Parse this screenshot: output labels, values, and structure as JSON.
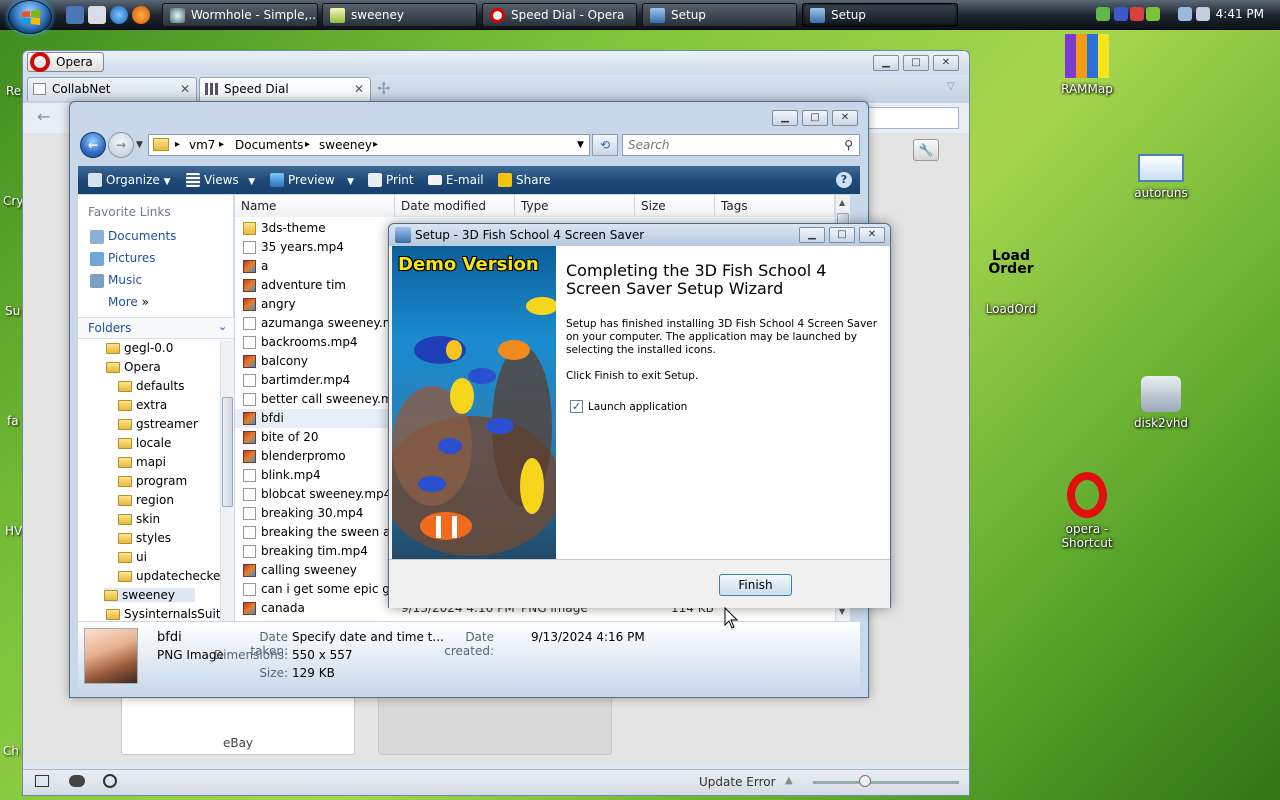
{
  "taskbar": {
    "tasks": [
      {
        "label": "Wormhole - Simple,..."
      },
      {
        "label": "sweeney"
      },
      {
        "label": "Speed Dial - Opera"
      },
      {
        "label": "Setup"
      },
      {
        "label": "Setup"
      }
    ],
    "clock": "4:41 PM"
  },
  "desktop": {
    "icons": [
      {
        "label": "RAMMap"
      },
      {
        "label": "autoruns"
      },
      {
        "label": "LoadOrd",
        "logo_text": "Load Order"
      },
      {
        "label": "disk2vhd"
      },
      {
        "label": "opera - Shortcut"
      }
    ],
    "edge_labels": [
      "Re",
      "Cry",
      "Su",
      "fa",
      "HV",
      "Ch"
    ]
  },
  "opera": {
    "menu_label": "Opera",
    "tabs": [
      {
        "label": "CollabNet"
      },
      {
        "label": "Speed Dial"
      }
    ],
    "add_tab": "✢",
    "dial_tile_label": "eBay",
    "status": {
      "update_text": "Update Error"
    }
  },
  "explorer": {
    "breadcrumb": [
      "vm7",
      "Documents",
      "sweeney"
    ],
    "search_placeholder": "Search",
    "toolbar": {
      "organize": "Organize",
      "views": "Views",
      "preview": "Preview",
      "print": "Print",
      "email": "E-mail",
      "share": "Share"
    },
    "favorite_links_header": "Favorite Links",
    "favorite_links": [
      "Documents",
      "Pictures",
      "Music"
    ],
    "more_label": "More",
    "folders_header": "Folders",
    "tree": [
      {
        "label": "gegl-0.0",
        "level": 0
      },
      {
        "label": "Opera",
        "level": 0
      },
      {
        "label": "defaults",
        "level": 1
      },
      {
        "label": "extra",
        "level": 1
      },
      {
        "label": "gstreamer",
        "level": 1
      },
      {
        "label": "locale",
        "level": 1
      },
      {
        "label": "mapi",
        "level": 1
      },
      {
        "label": "program",
        "level": 1
      },
      {
        "label": "region",
        "level": 1
      },
      {
        "label": "skin",
        "level": 1
      },
      {
        "label": "styles",
        "level": 1
      },
      {
        "label": "ui",
        "level": 1
      },
      {
        "label": "updatechecker",
        "level": 1
      },
      {
        "label": "sweeney",
        "level": 0,
        "selected": true
      },
      {
        "label": "SysinternalsSuite",
        "level": 0
      }
    ],
    "columns": [
      "Name",
      "Date modified",
      "Type",
      "Size",
      "Tags"
    ],
    "files": [
      {
        "name": "3ds-theme",
        "kind": "fold"
      },
      {
        "name": "35 years.mp4",
        "kind": "mp4"
      },
      {
        "name": "a",
        "kind": "png"
      },
      {
        "name": "adventure tim",
        "kind": "png"
      },
      {
        "name": "angry",
        "kind": "png"
      },
      {
        "name": "azumanga sweeney.mp4",
        "kind": "mp4"
      },
      {
        "name": "backrooms.mp4",
        "kind": "mp4"
      },
      {
        "name": "balcony",
        "kind": "png"
      },
      {
        "name": "bartimder.mp4",
        "kind": "mp4"
      },
      {
        "name": "better call sweeney.mp4",
        "kind": "mp4"
      },
      {
        "name": "bfdi",
        "kind": "png",
        "selected": true
      },
      {
        "name": "bite of 20",
        "kind": "png"
      },
      {
        "name": "blenderpromo",
        "kind": "png"
      },
      {
        "name": "blink.mp4",
        "kind": "mp4"
      },
      {
        "name": "blobcat sweeney.mp4",
        "kind": "mp4"
      },
      {
        "name": "breaking 30.mp4",
        "kind": "mp4"
      },
      {
        "name": "breaking the sween at ...",
        "kind": "mp4"
      },
      {
        "name": "breaking tim.mp4",
        "kind": "mp4"
      },
      {
        "name": "calling sweeney",
        "kind": "png"
      },
      {
        "name": "can i get some epic ga...",
        "kind": "mp4"
      },
      {
        "name": "canada",
        "kind": "png"
      }
    ],
    "partial_row": {
      "date": "9/13/2024 4:16 PM",
      "type": "PNG image",
      "size": "114 KB"
    },
    "details": {
      "name": "bfdi",
      "type": "PNG Image",
      "date_taken_label": "Date taken:",
      "date_taken_value": "Specify date and time t...",
      "date_created_label": "Date created:",
      "date_created_value": "9/13/2024 4:16 PM",
      "dimensions_label": "Dimensions:",
      "dimensions_value": "550 x 557",
      "size_label": "Size:",
      "size_value": "129 KB"
    }
  },
  "setup": {
    "title": "Setup - 3D Fish School 4 Screen Saver",
    "banner_text": "Demo Version",
    "heading": "Completing the 3D Fish School 4 Screen Saver Setup Wizard",
    "body": "Setup has finished installing 3D Fish School 4 Screen Saver on your computer. The application may be launched by selecting the installed icons.",
    "click_finish": "Click Finish to exit Setup.",
    "checkbox_label": "Launch application",
    "checkbox_checked": "✓",
    "finish_label": "Finish"
  },
  "colors": {
    "accent_blue": "#1f50a3",
    "toolbar_blue": "#1f4a78",
    "banner_yellow": "#f7e51c"
  }
}
